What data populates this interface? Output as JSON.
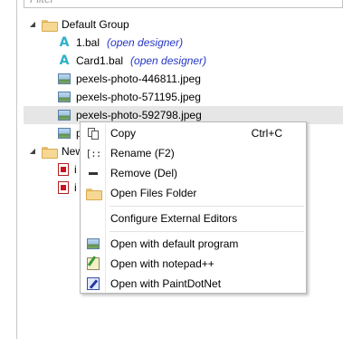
{
  "filter": {
    "placeholder": "Filter"
  },
  "tree": {
    "default_group": {
      "label": "Default Group",
      "items": [
        {
          "label": "1.bal",
          "extra": "(open designer)"
        },
        {
          "label": "Card1.bal",
          "extra": "(open designer)"
        },
        {
          "label": "pexels-photo-446811.jpeg"
        },
        {
          "label": "pexels-photo-571195.jpeg"
        },
        {
          "label": "pexels-photo-592798.jpeg"
        },
        {
          "label": "p"
        }
      ]
    },
    "new_group": {
      "label": "New",
      "items": [
        {
          "label": "i"
        },
        {
          "label": "i"
        }
      ]
    }
  },
  "context_menu": {
    "copy": {
      "label": "Copy",
      "shortcut": "Ctrl+C"
    },
    "rename": {
      "label": "Rename (F2)"
    },
    "remove": {
      "label": "Remove (Del)"
    },
    "open_files_folder": {
      "label": "Open Files Folder"
    },
    "configure_editors": {
      "label": "Configure External Editors"
    },
    "open_default": {
      "label": "Open with default program"
    },
    "open_notepad": {
      "label": "Open with notepad++"
    },
    "open_paintdotnet": {
      "label": "Open with PaintDotNet"
    }
  },
  "colors": {
    "selection_bg": "#e6e6e6",
    "link_blue": "#2436c6",
    "bal_icon": "#2cb0c9"
  }
}
